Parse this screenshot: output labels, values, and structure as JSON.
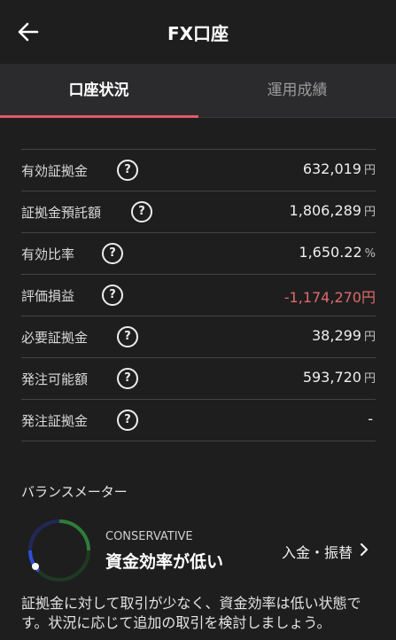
{
  "header": {
    "title": "FX口座",
    "back_icon": "back-arrow-icon"
  },
  "tabs": [
    {
      "label": "口座状況",
      "active": true
    },
    {
      "label": "運用成績",
      "active": false
    }
  ],
  "account": {
    "rows": [
      {
        "label": "有効証拠金",
        "value": "632,019",
        "unit": "円"
      },
      {
        "label": "証拠金預託額",
        "value": "1,806,289",
        "unit": "円"
      },
      {
        "label": "有効比率",
        "value": "1,650.22",
        "unit": "%"
      },
      {
        "label": "評価損益",
        "value": "-1,174,270",
        "unit": "円"
      },
      {
        "label": "必要証拠金",
        "value": "38,299",
        "unit": "円"
      },
      {
        "label": "発注可能額",
        "value": "593,720",
        "unit": "円"
      },
      {
        "label": "発注証拠金",
        "value": "-",
        "unit": ""
      }
    ],
    "help_icon_text": "?"
  },
  "balance_meter": {
    "title": "バランスメーター",
    "level_en": "CONSERVATIVE",
    "level_ja": "資金効率が低い",
    "deposit_link": "入金・振替",
    "description": "証拠金に対して取引が少なく、資金効率は低い状態です。状況に応じて追加の取引を検討しましょう。"
  },
  "colors": {
    "background": "#1e1e1f",
    "tab_indicator": "#e05a6a",
    "negative": "#e06a6a",
    "gauge_blue": "#2f4fd6",
    "gauge_green": "#2e7d3a"
  }
}
